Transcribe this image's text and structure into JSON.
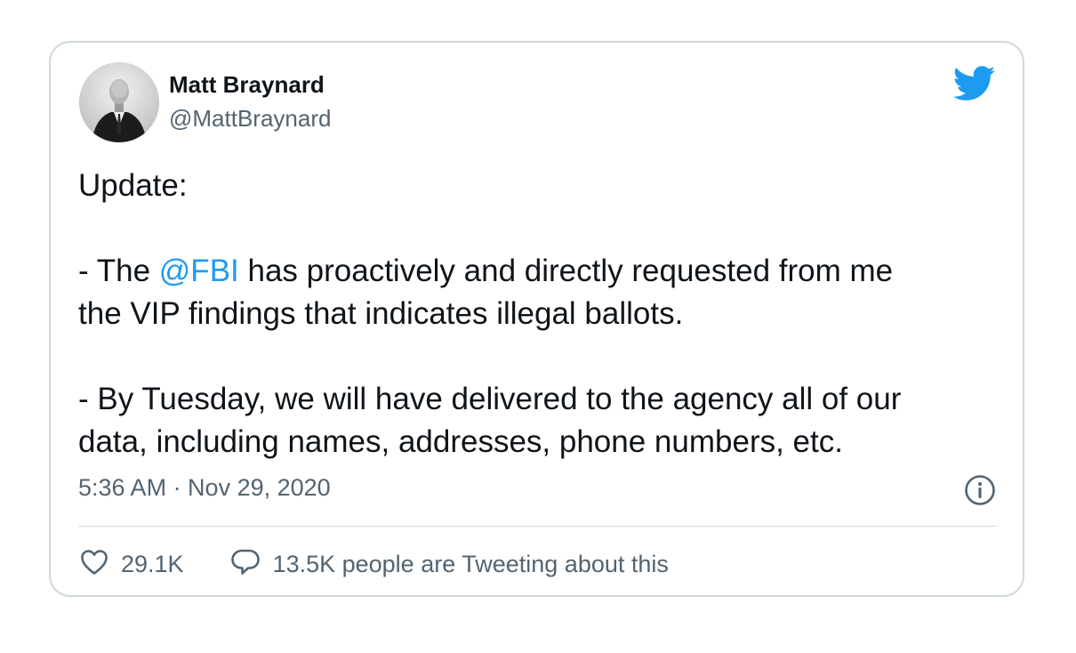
{
  "author": {
    "name": "Matt Braynard",
    "handle": "@MattBraynard"
  },
  "tweet": {
    "line1": "Update:",
    "line2_prefix": "- The ",
    "line2_mention": "@FBI",
    "line2_suffix": " has proactively and directly requested from me",
    "line3": "the VIP findings that indicates illegal ballots.",
    "line4": "- By Tuesday, we will have delivered to the agency all of our",
    "line5": "data, including names, addresses, phone numbers, etc.",
    "timestamp": "5:36 AM · Nov 29, 2020"
  },
  "actions": {
    "likes": "29.1K",
    "replies": "13.5K people are Tweeting about this"
  },
  "icons": {
    "brand": "twitter-bird-icon",
    "info": "info-icon",
    "like": "heart-icon",
    "reply": "speech-bubble-icon"
  },
  "colors": {
    "brand": "#1d9bf0",
    "text": "#0f1419",
    "muted": "#536471",
    "border": "#cfd9de"
  }
}
